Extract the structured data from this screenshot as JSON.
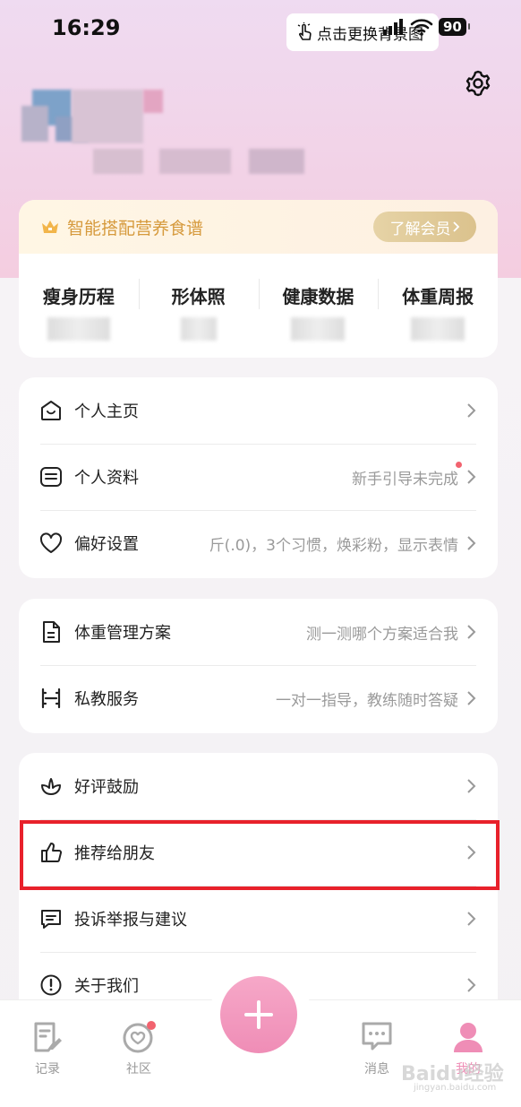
{
  "status_bar": {
    "time": "16:29",
    "tip": "点击更换背景图",
    "battery": "90"
  },
  "vip": {
    "title": "智能搭配营养食谱",
    "button": "了解会员"
  },
  "stats": [
    {
      "label": "瘦身历程"
    },
    {
      "label": "形体照"
    },
    {
      "label": "健康数据"
    },
    {
      "label": "体重周报"
    }
  ],
  "menu_group_1": [
    {
      "label": "个人主页",
      "value": "",
      "icon": "home-smile-icon"
    },
    {
      "label": "个人资料",
      "value": "新手引导未完成",
      "icon": "profile-card-icon"
    },
    {
      "label": "偏好设置",
      "value": "斤(.0)，3个习惯，焕彩粉，显示表情",
      "icon": "heart-icon"
    }
  ],
  "menu_group_2": [
    {
      "label": "体重管理方案",
      "value": "测一测哪个方案适合我",
      "icon": "document-icon"
    },
    {
      "label": "私教服务",
      "value": "一对一指导，教练随时答疑",
      "icon": "dumbbell-icon"
    }
  ],
  "menu_group_3": [
    {
      "label": "好评鼓励",
      "value": "",
      "icon": "flower-icon"
    },
    {
      "label": "推荐给朋友",
      "value": "",
      "icon": "thumbs-up-icon"
    },
    {
      "label": "投诉举报与建议",
      "value": "",
      "icon": "feedback-icon"
    },
    {
      "label": "关于我们",
      "value": "",
      "icon": "info-icon"
    }
  ],
  "tabbar": [
    {
      "label": "记录",
      "icon": "record-icon"
    },
    {
      "label": "社区",
      "icon": "community-icon"
    },
    {
      "label": "消息",
      "icon": "message-icon"
    },
    {
      "label": "我的",
      "icon": "profile-icon"
    }
  ],
  "watermark": {
    "main": "Baidu经验",
    "sub": "jingyan.baidu.com"
  },
  "colors": {
    "accent_pink": "#ef8db6",
    "gold": "#d69a3d",
    "highlight": "#e8212b"
  }
}
